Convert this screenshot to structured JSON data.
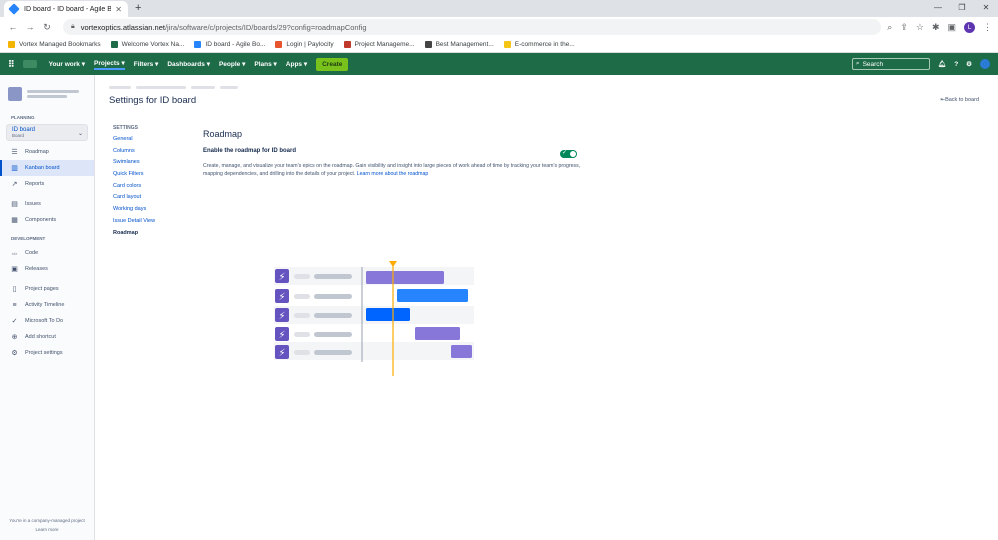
{
  "browser": {
    "tab_title": "ID board - ID board - Agile Boa",
    "url_domain": "vortexoptics.atlassian.net",
    "url_path": "/jira/software/c/projects/ID/boards/29?config=roadmapConfig",
    "profile_initial": "L",
    "bookmarks": [
      {
        "label": "Vortex Managed Bookmarks",
        "color": "#f4b400"
      },
      {
        "label": "Welcome Vortex Na...",
        "color": "#1e6b48"
      },
      {
        "label": "ID board - Agile Bo...",
        "color": "#2684ff"
      },
      {
        "label": "Login | Paylocity",
        "color": "#e8542d"
      },
      {
        "label": "Project Manageme...",
        "color": "#c0392b"
      },
      {
        "label": "Best Management...",
        "color": "#444444"
      },
      {
        "label": "E-commerce in the...",
        "color": "#f5c518"
      }
    ]
  },
  "jira_nav": {
    "items": [
      "Your work",
      "Projects",
      "Filters",
      "Dashboards",
      "People",
      "Plans",
      "Apps"
    ],
    "create": "Create",
    "search_placeholder": "Search"
  },
  "sidebar": {
    "planning_heading": "PLANNING",
    "board_name": "ID board",
    "board_type": "Board",
    "planning_items": [
      {
        "label": "Roadmap",
        "icon": "roadmap-icon"
      },
      {
        "label": "Kanban board",
        "icon": "kanban-icon"
      },
      {
        "label": "Reports",
        "icon": "reports-icon"
      }
    ],
    "other_items": [
      {
        "label": "Issues",
        "icon": "issues-icon"
      },
      {
        "label": "Components",
        "icon": "components-icon"
      }
    ],
    "development_heading": "DEVELOPMENT",
    "development_items": [
      {
        "label": "Code",
        "icon": "code-icon"
      },
      {
        "label": "Releases",
        "icon": "releases-icon"
      }
    ],
    "extra_items": [
      {
        "label": "Project pages",
        "icon": "pages-icon"
      },
      {
        "label": "Activity Timeline",
        "icon": "timeline-icon"
      },
      {
        "label": "Microsoft To Do",
        "icon": "todo-icon"
      },
      {
        "label": "Add shortcut",
        "icon": "shortcut-icon"
      },
      {
        "label": "Project settings",
        "icon": "settings-icon"
      }
    ],
    "footer_text": "You're in a company-managed project",
    "footer_link": "Learn more"
  },
  "page": {
    "title": "Settings for ID board",
    "back_link": "Back to board"
  },
  "settings_nav": {
    "heading": "SETTINGS",
    "items": [
      "General",
      "Columns",
      "Swimlanes",
      "Quick Filters",
      "Card colors",
      "Card layout",
      "Working days",
      "Issue Detail View",
      "Roadmap"
    ]
  },
  "roadmap": {
    "heading": "Roadmap",
    "enable_label": "Enable the roadmap for ID board",
    "enabled": true,
    "description": "Create, manage, and visualize your team's epics on the roadmap. Gain visibility and insight into large pieces of work ahead of time by tracking your team's progress, mapping dependencies, and drilling into the details of your project.",
    "learn_more": "Learn more about the roadmap"
  }
}
